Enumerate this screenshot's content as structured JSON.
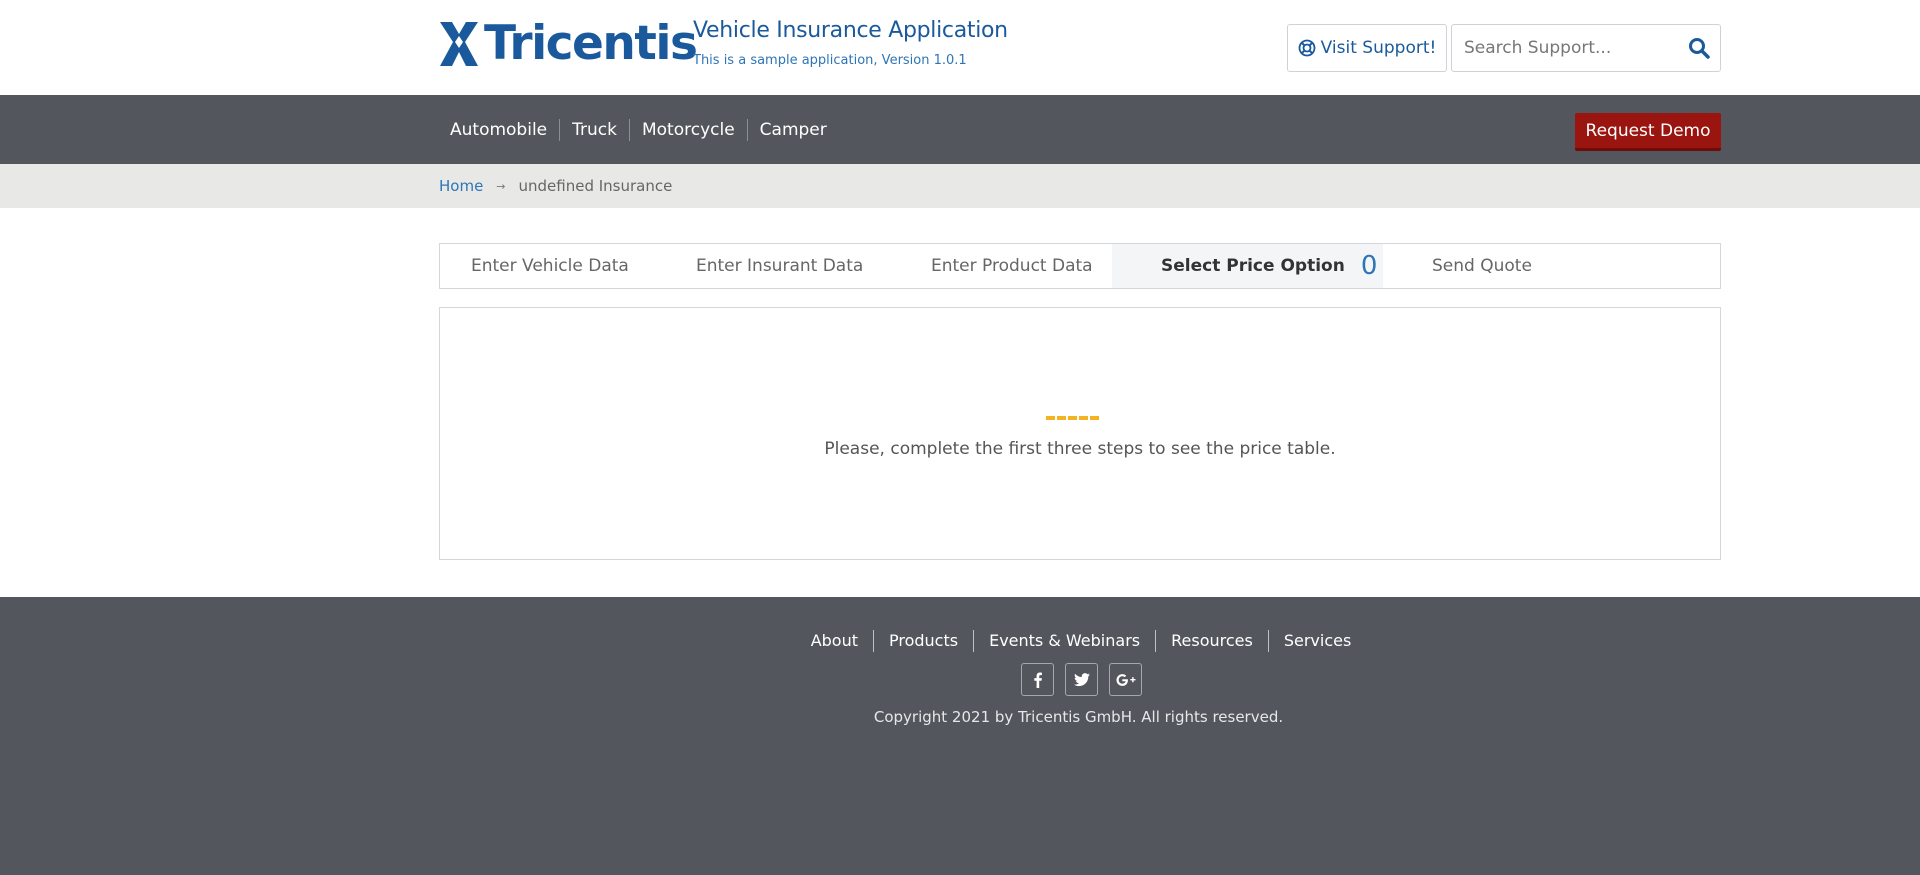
{
  "header": {
    "logo_text": "Tricentis",
    "app_title": "Vehicle Insurance Application",
    "app_subtitle": "This is a sample application, Version 1.0.1",
    "support_label": "Visit Support!",
    "search_placeholder": "Search Support..."
  },
  "nav": {
    "items": [
      {
        "label": "Automobile"
      },
      {
        "label": "Truck"
      },
      {
        "label": "Motorcycle"
      },
      {
        "label": "Camper"
      }
    ],
    "demo_label": "Request Demo"
  },
  "breadcrumb": {
    "home": "Home",
    "separator": "→",
    "current": "undefined Insurance"
  },
  "steps": [
    {
      "label": "Enter Vehicle Data"
    },
    {
      "label": "Enter Insurant Data"
    },
    {
      "label": "Enter Product Data"
    },
    {
      "label": "Select Price Option",
      "count": "0",
      "active": true
    },
    {
      "label": "Send Quote"
    }
  ],
  "panel": {
    "message": "Please, complete the first three steps to see the price table."
  },
  "footer": {
    "links": [
      {
        "label": "About"
      },
      {
        "label": "Products"
      },
      {
        "label": "Events & Webinars"
      },
      {
        "label": "Resources"
      },
      {
        "label": "Services"
      }
    ],
    "social": [
      {
        "icon": "facebook-icon"
      },
      {
        "icon": "twitter-icon"
      },
      {
        "icon": "google-plus-icon"
      }
    ],
    "copyright": "Copyright 2021 by Tricentis GmbH. All rights reserved."
  },
  "colors": {
    "brand_blue": "#1a5a9c",
    "nav_bg": "#53565c",
    "demo_red": "#9a1510",
    "loader_orange": "#f4b323"
  }
}
